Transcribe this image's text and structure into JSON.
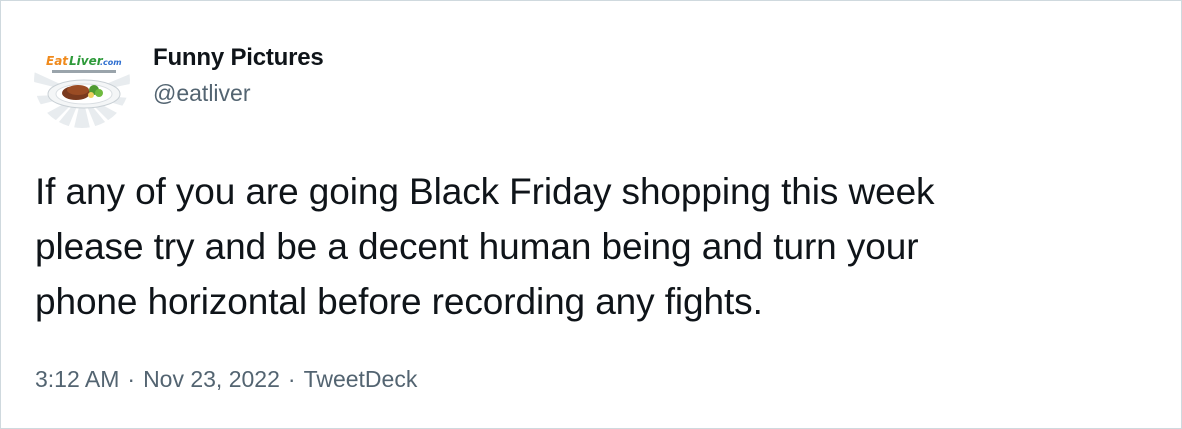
{
  "author": {
    "display_name": "Funny Pictures",
    "handle": "@eatliver",
    "avatar": {
      "icon": "eatliver-logo-icon",
      "logo_text": "EatLiver.com",
      "logo_tagline": "Crazy Pictures of the Pound Internet"
    }
  },
  "tweet": {
    "text": "If any of you are going Black Friday shopping this week\nplease try and be a decent human being and turn your\nphone horizontal before recording any fights."
  },
  "meta": {
    "time": "3:12 AM",
    "separator": "·",
    "date": "Nov 23, 2022",
    "source": "TweetDeck"
  },
  "colors": {
    "text_primary": "#0f1419",
    "text_secondary": "#536471",
    "border": "#cfd9de",
    "logo_green": "#2e9a3a",
    "logo_orange": "#f08a1c",
    "logo_blue": "#2f6fd0"
  }
}
